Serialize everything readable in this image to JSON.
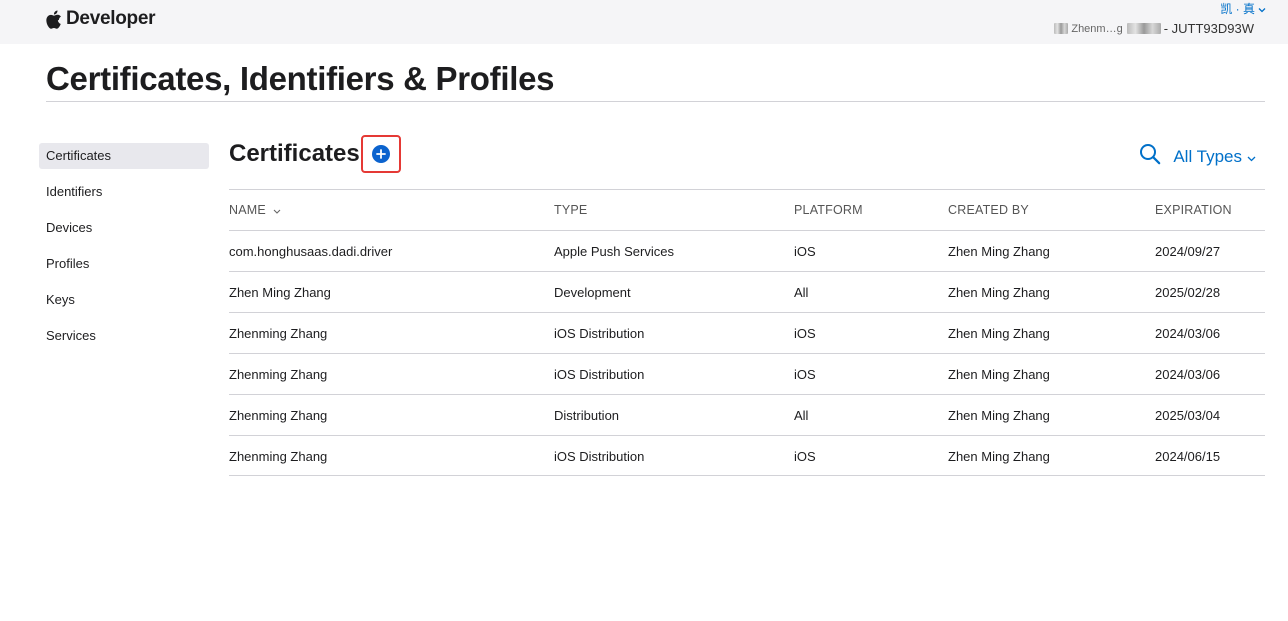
{
  "header": {
    "brand": "Developer",
    "account_menu": "凯 · 真",
    "account_name": "Zhenm…g",
    "team_id": "- JUTT93D93W"
  },
  "page": {
    "title": "Certificates, Identifiers & Profiles"
  },
  "sidebar": {
    "items": [
      {
        "label": "Certificates",
        "active": true
      },
      {
        "label": "Identifiers"
      },
      {
        "label": "Devices"
      },
      {
        "label": "Profiles"
      },
      {
        "label": "Keys"
      },
      {
        "label": "Services"
      }
    ]
  },
  "section": {
    "title": "Certificates",
    "filter_label": "All Types"
  },
  "table": {
    "columns": [
      "NAME",
      "TYPE",
      "PLATFORM",
      "CREATED BY",
      "EXPIRATION"
    ],
    "rows": [
      [
        "com.honghusaas.dadi.driver",
        "Apple Push Services",
        "iOS",
        "Zhen Ming Zhang",
        "2024/09/27"
      ],
      [
        "Zhen Ming Zhang",
        "Development",
        "All",
        "Zhen Ming Zhang",
        "2025/02/28"
      ],
      [
        "Zhenming Zhang",
        "iOS Distribution",
        "iOS",
        "Zhen Ming Zhang",
        "2024/03/06"
      ],
      [
        "Zhenming Zhang",
        "iOS Distribution",
        "iOS",
        "Zhen Ming Zhang",
        "2024/03/06"
      ],
      [
        "Zhenming Zhang",
        "Distribution",
        "All",
        "Zhen Ming Zhang",
        "2025/03/04"
      ],
      [
        "Zhenming Zhang",
        "iOS Distribution",
        "iOS",
        "Zhen Ming Zhang",
        "2024/06/15"
      ]
    ]
  },
  "icons": {
    "brand": "apple-logo-icon",
    "add": "plus-circle-icon",
    "search": "search-icon",
    "dropdown": "chevron-down-icon"
  },
  "colors": {
    "accent": "#0070c9",
    "add_button": "#0b63ce",
    "highlight_box": "#e53935",
    "topbar_bg": "#f5f5f7",
    "sidebar_active_bg": "#e8e8ed"
  }
}
